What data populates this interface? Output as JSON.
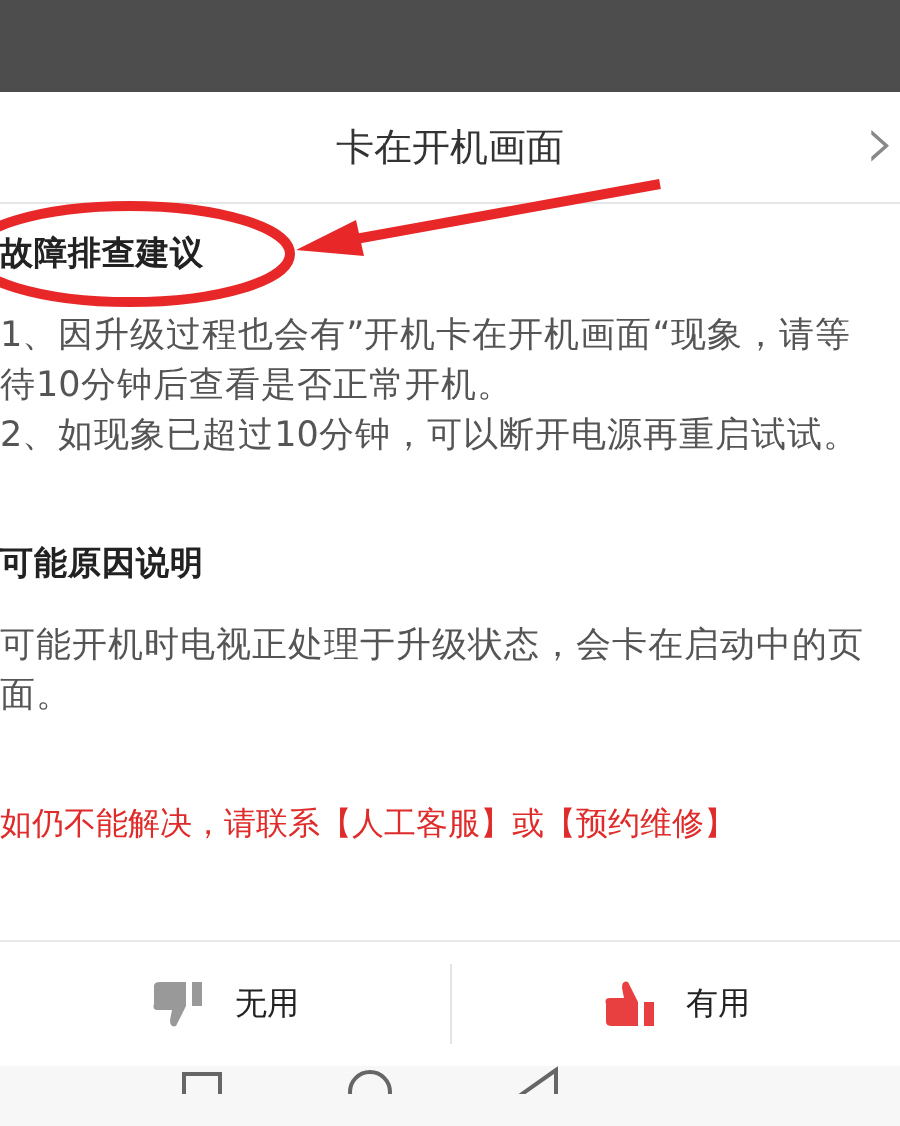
{
  "sheet": {
    "title": "卡在开机画面",
    "close_icon": "›"
  },
  "sections": [
    {
      "heading": "故障排查建议",
      "paragraphs": [
        "1、因升级过程也会有”开机卡在开机画面“现象，请等待10分钟后查看是否正常开机。",
        "2、如现象已超过10分钟，可以断开电源再重启试试。"
      ],
      "annotated": true
    },
    {
      "heading": "可能原因说明",
      "paragraphs": [
        "可能开机时电视正处理于升级状态，会卡在启动中的页面。"
      ],
      "annotated": false
    }
  ],
  "notice": "如仍不能解决，请联系【人工客服】或【预约维修】",
  "feedback": [
    {
      "kind": "down",
      "label": "无用"
    },
    {
      "kind": "up",
      "label": "有用"
    }
  ]
}
